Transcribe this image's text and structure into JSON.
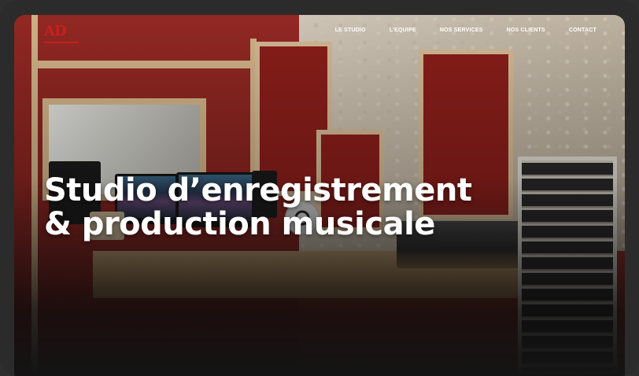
{
  "brand": {
    "logo_text": "AD"
  },
  "nav": {
    "items": [
      {
        "label": "LE STUDIO"
      },
      {
        "label": "L'EQUIPE"
      },
      {
        "label": "NOS SERVICES"
      },
      {
        "label": "NOS CLIENTS"
      },
      {
        "label": "CONTACT"
      }
    ]
  },
  "hero": {
    "title_line1": "Studio d’enregistrement",
    "title_line2": "& production musicale"
  },
  "colors": {
    "accent": "#c8201d",
    "panel_red": "#8f1f1b",
    "nav_text": "#ffffff"
  }
}
